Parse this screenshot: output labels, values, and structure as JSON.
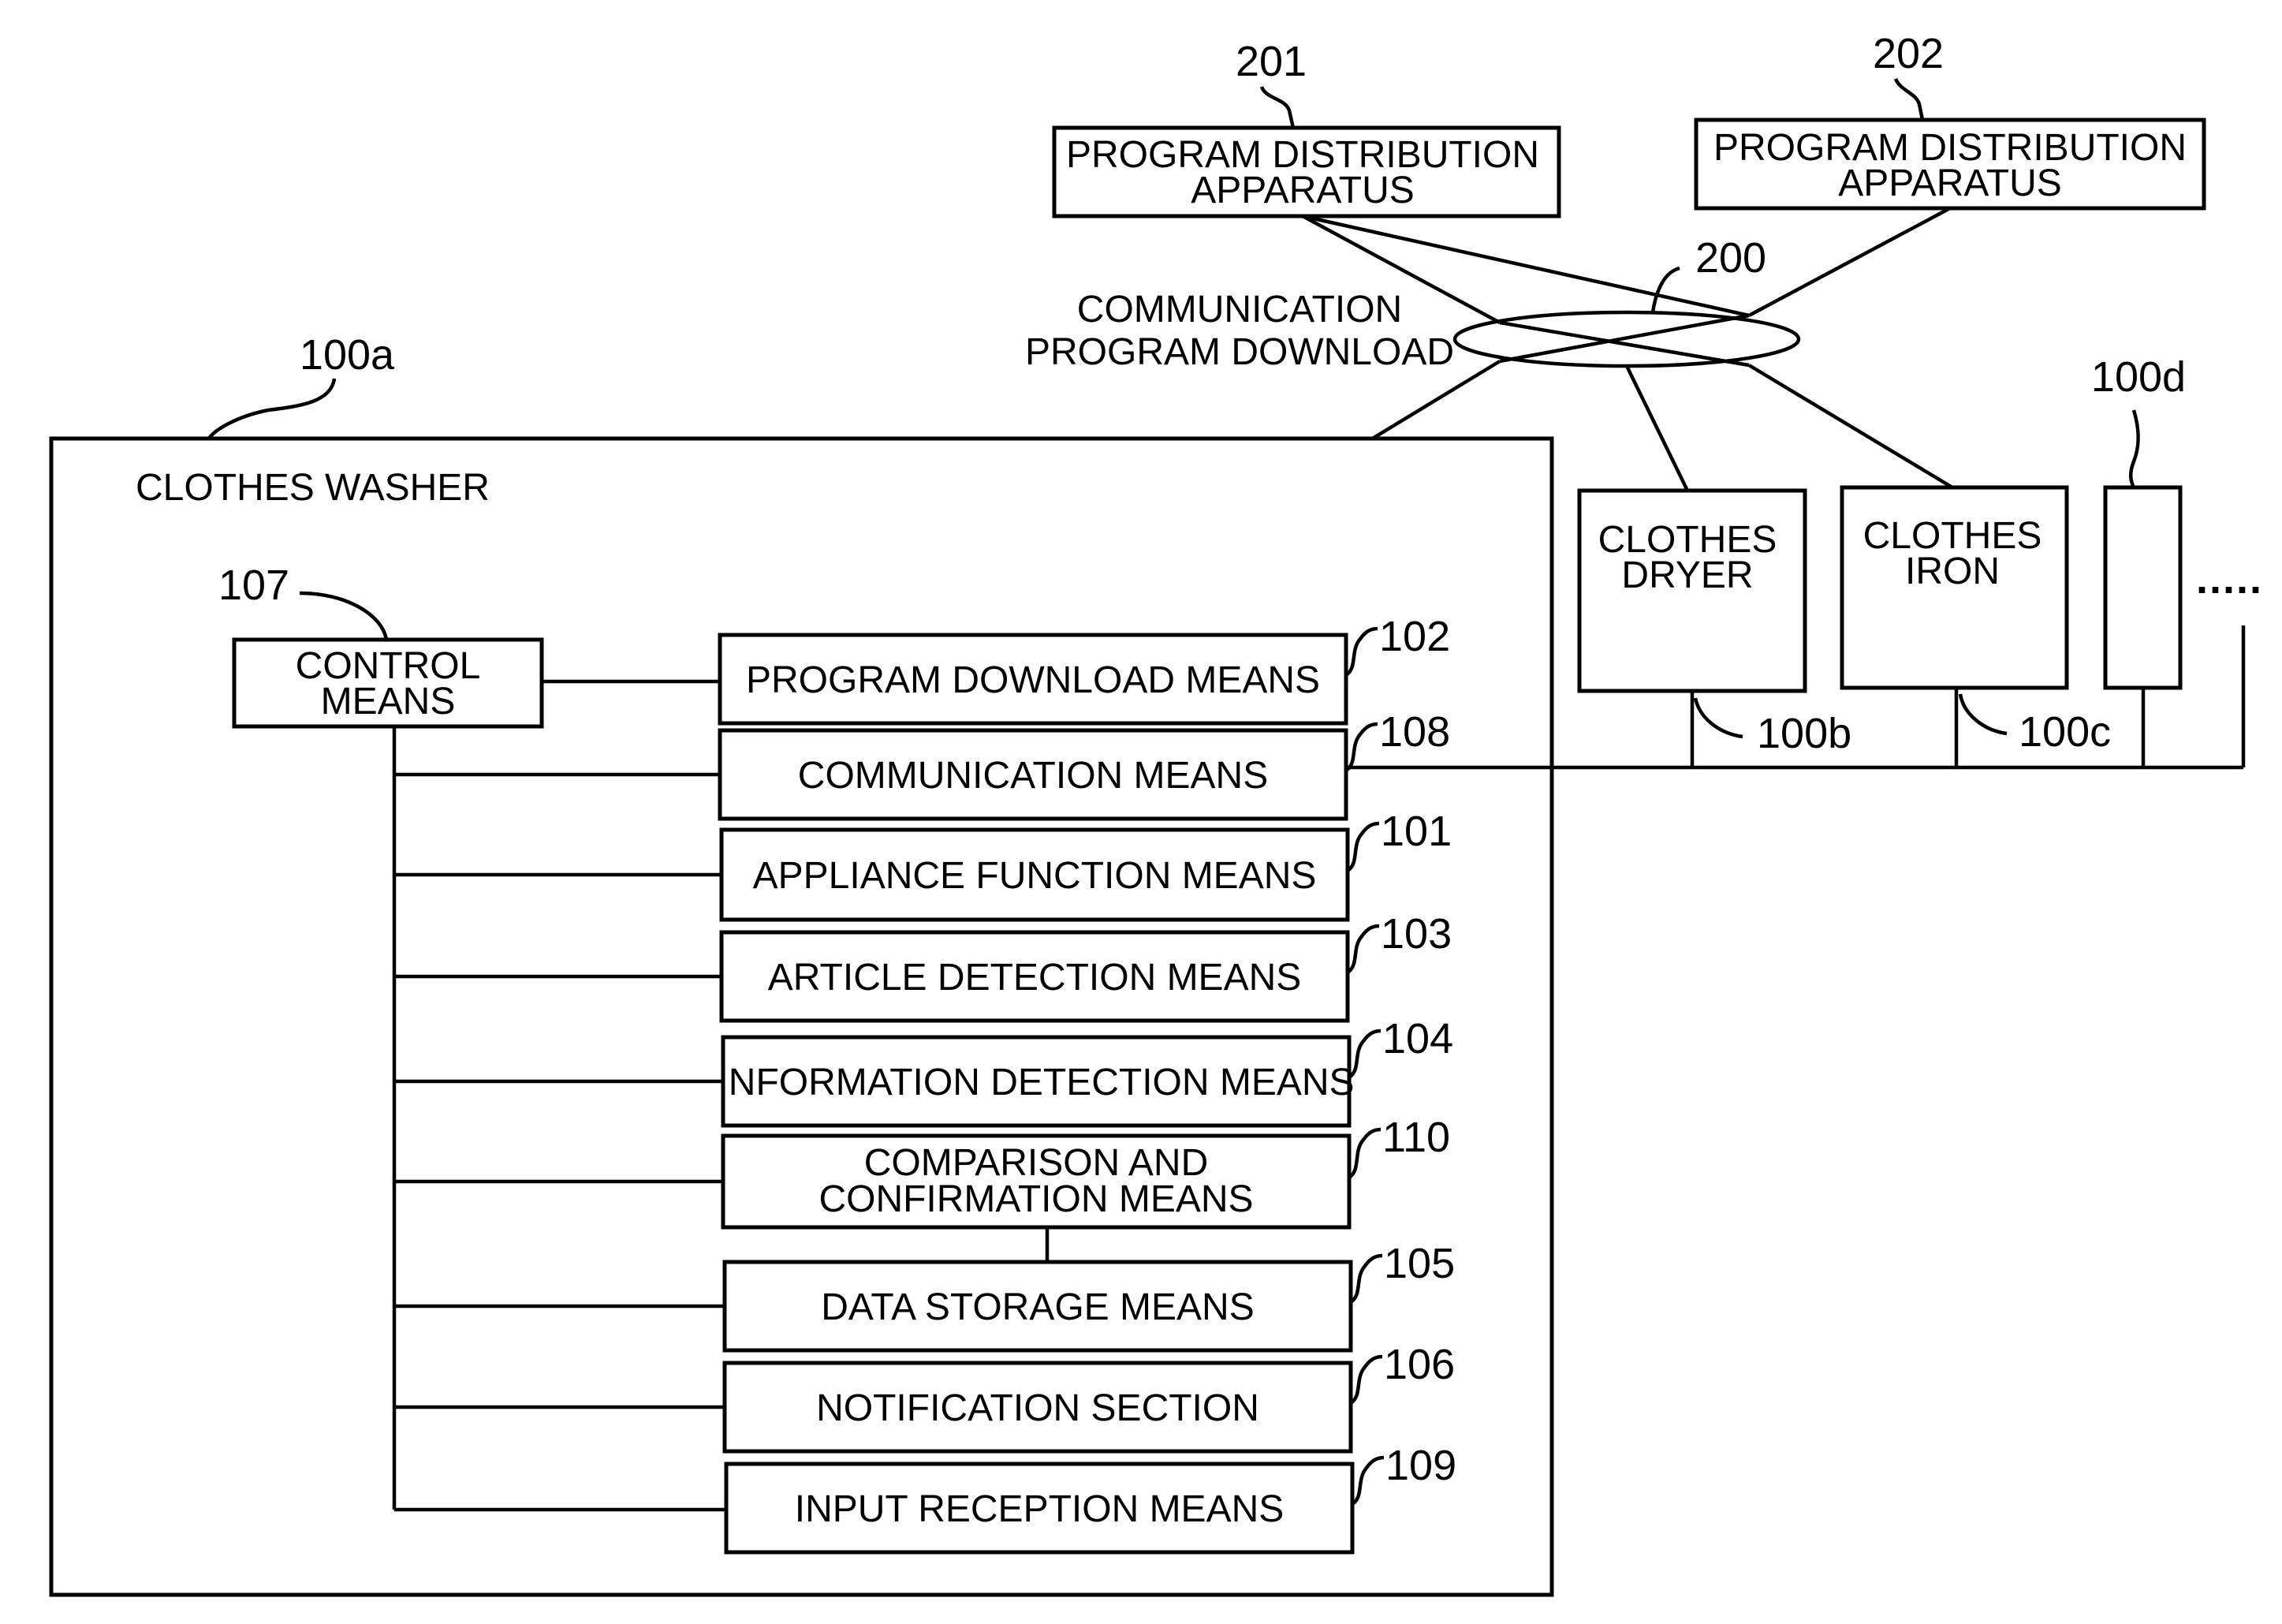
{
  "diagram": {
    "network": {
      "ref": "200",
      "label_lines": [
        "COMMUNICATION",
        "PROGRAM DOWNLOAD"
      ]
    },
    "distribution_apparatuses": [
      {
        "ref": "201",
        "lines": [
          "PROGRAM DISTRIBUTION",
          "APPARATUS"
        ]
      },
      {
        "ref": "202",
        "lines": [
          "PROGRAM DISTRIBUTION",
          "APPARATUS"
        ]
      }
    ],
    "washer": {
      "ref": "100a",
      "title": "CLOTHES WASHER",
      "control": {
        "ref": "107",
        "lines": [
          "CONTROL",
          "MEANS"
        ]
      },
      "modules": [
        {
          "ref": "102",
          "lines": [
            "PROGRAM DOWNLOAD MEANS"
          ]
        },
        {
          "ref": "108",
          "lines": [
            "COMMUNICATION MEANS"
          ]
        },
        {
          "ref": "101",
          "lines": [
            "APPLIANCE FUNCTION MEANS"
          ]
        },
        {
          "ref": "103",
          "lines": [
            "ARTICLE DETECTION MEANS"
          ]
        },
        {
          "ref": "104",
          "lines": [
            "INFORMATION DETECTION MEANS"
          ]
        },
        {
          "ref": "110",
          "lines": [
            "COMPARISON AND",
            "CONFIRMATION MEANS"
          ]
        },
        {
          "ref": "105",
          "lines": [
            "DATA STORAGE MEANS"
          ]
        },
        {
          "ref": "106",
          "lines": [
            "NOTIFICATION SECTION"
          ]
        },
        {
          "ref": "109",
          "lines": [
            "INPUT RECEPTION MEANS"
          ]
        }
      ]
    },
    "other_appliances": [
      {
        "ref": "100b",
        "lines": [
          "CLOTHES",
          "DRYER"
        ]
      },
      {
        "ref": "100c",
        "lines": [
          "CLOTHES",
          "IRON"
        ]
      },
      {
        "ref": "100d",
        "lines": []
      }
    ],
    "ellipsis": "....."
  }
}
